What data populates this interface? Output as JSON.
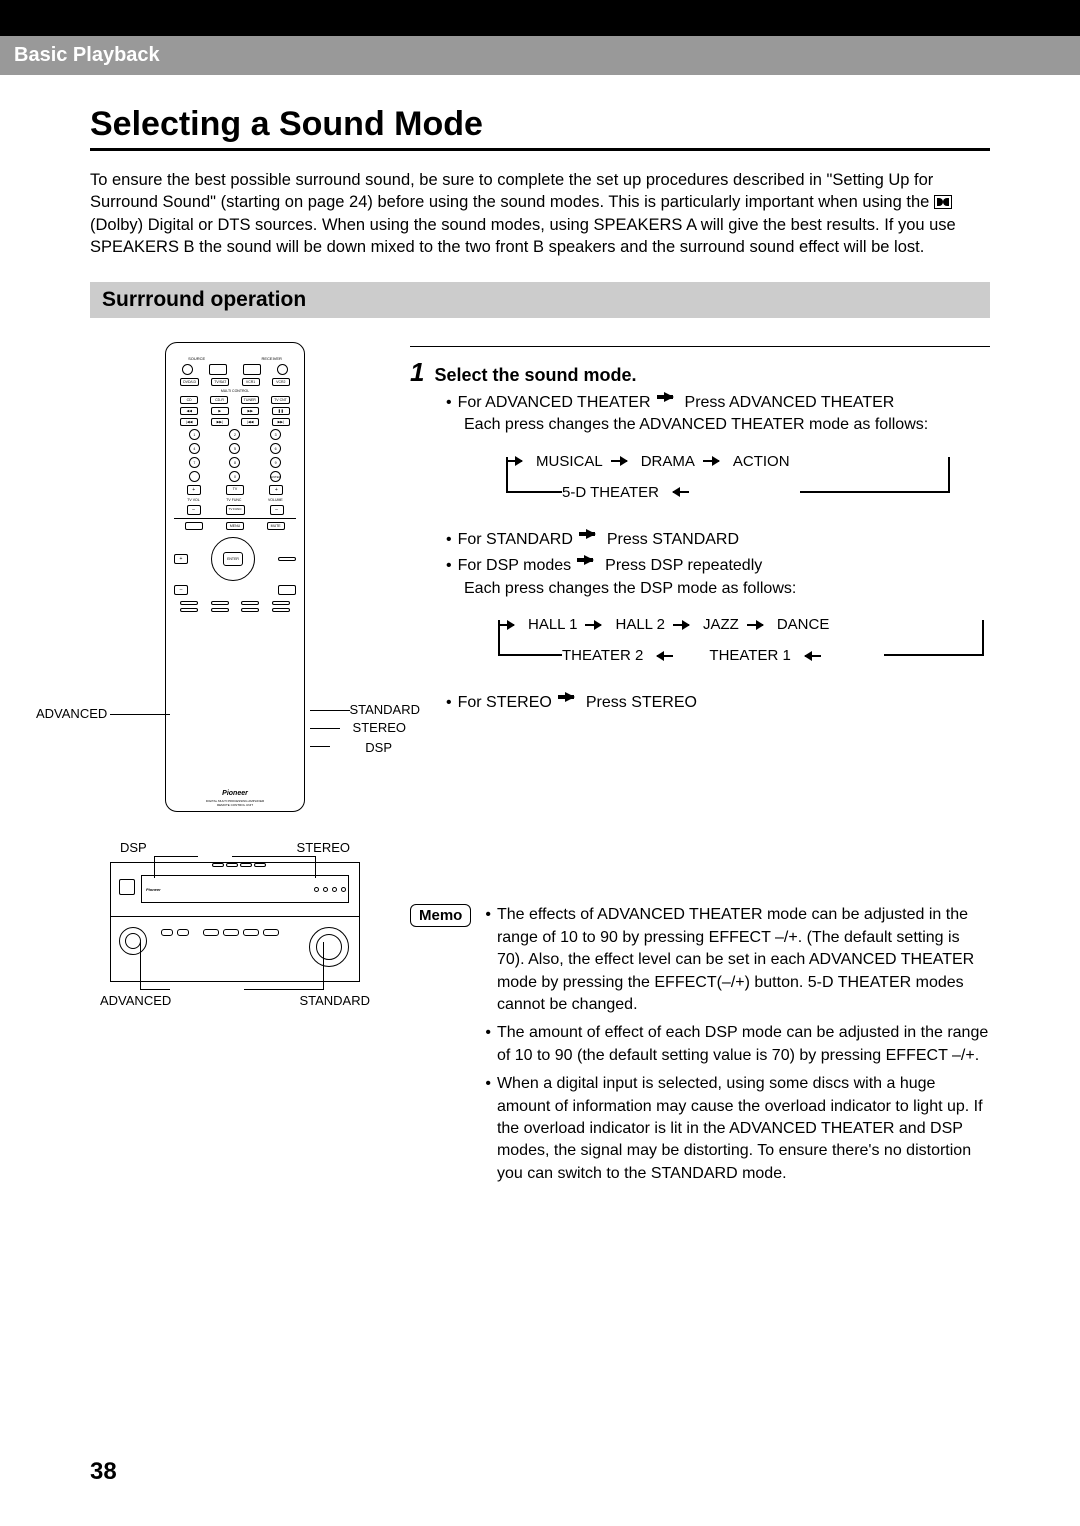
{
  "section_header": "Basic Playback",
  "main_title": "Selecting a Sound Mode",
  "intro_part1": "To ensure the best possible surround sound, be sure to complete the set up procedures described in \"Setting Up for Surround Sound\" (starting on page 24) before using the sound modes. This is particularly important when using the ",
  "intro_part2": " (Dolby) Digital or DTS sources. When using the sound modes, using SPEAKERS A will give the best results. If you use SPEAKERS B the sound will be down mixed to the two front B speakers and the surround sound effect will be lost.",
  "sub_header": "Surrround operation",
  "remote_labels": {
    "advanced": "ADVANCED",
    "standard": "STANDARD",
    "stereo": "STEREO",
    "dsp": "DSP"
  },
  "receiver_labels": {
    "dsp": "DSP",
    "stereo": "STEREO",
    "advanced": "ADVANCED",
    "standard": "STANDARD"
  },
  "step": {
    "num": "1",
    "title": "Select the sound mode.",
    "adv_line1": "For ADVANCED THEATER",
    "adv_line1b": "Press ADVANCED THEATER",
    "adv_line2": "Each press changes the ADVANCED THEATER mode as follows:",
    "adv_cycle": [
      "MUSICAL",
      "DRAMA",
      "ACTION",
      "5-D THEATER"
    ],
    "std_line": "For STANDARD",
    "std_line_b": "Press STANDARD",
    "dsp_line": "For DSP modes",
    "dsp_line_b": "Press DSP repeatedly",
    "dsp_line2": "Each press changes the DSP mode as follows:",
    "dsp_cycle": [
      "HALL 1",
      "HALL 2",
      "JAZZ",
      "DANCE",
      "THEATER 2",
      "THEATER 1"
    ],
    "stereo_line": "For STEREO",
    "stereo_line_b": "Press STEREO"
  },
  "memo_label": "Memo",
  "memo": {
    "m1": "The effects of ADVANCED THEATER mode can be adjusted in the range of 10 to 90 by pressing EFFECT –/+. (The default setting is 70). Also, the effect level can be set in each ADVANCED THEATER mode by pressing the EFFECT(–/+) button. 5-D THEATER modes cannot be changed.",
    "m2": "The amount of effect of each DSP mode can be adjusted in the range of 10 to 90 (the default setting value is 70) by pressing EFFECT –/+.",
    "m3": "When a digital input is selected, using some discs with a huge amount of information may cause the overload indicator to light up. If the overload indicator is lit in the ADVANCED THEATER and DSP modes, the signal may be distorting. To ensure there's no distortion you can switch to the STANDARD mode."
  },
  "page_number": "38",
  "remote_tiny": {
    "source": "SOURCE",
    "receiver": "RECEIVER",
    "dvd": "DVD/LD",
    "tvsat": "TV/SAT",
    "vcr1": "VCR1",
    "vcr2": "VCR2",
    "cd": "CD",
    "cdr": "CD-R",
    "tuner": "TUNER",
    "tvcnt": "TV CNT",
    "multi": "MULTI CONTROL",
    "enter": "ENTER",
    "menu": "MENU",
    "mute": "MUTE",
    "tv": "TV",
    "tvvol": "TV VOL",
    "tvfunc": "TV FUNC",
    "vol": "VOLUME",
    "brand": "Pioneer",
    "sub": "DIGITAL MULTI PROCESSING AMPLIFIER\nREMOTE CONTROL UNIT"
  }
}
